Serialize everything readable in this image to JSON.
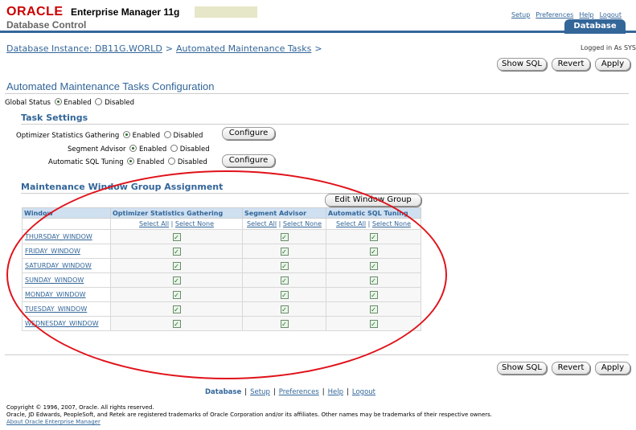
{
  "header": {
    "brand_oracle": "ORACLE",
    "brand_em": "Enterprise Manager 11g",
    "brand_dc": "Database Control",
    "global_links": [
      "Setup",
      "Preferences",
      "Help",
      "Logout"
    ],
    "tab": "Database"
  },
  "breadcrumb": {
    "items": [
      "Database Instance: DB11G.WORLD",
      "Automated Maintenance Tasks"
    ],
    "separator": ">"
  },
  "logged_in": "Logged in As SYS",
  "actions": {
    "show_sql": "Show SQL",
    "revert": "Revert",
    "apply": "Apply"
  },
  "page_title": "Automated Maintenance Tasks Configuration",
  "global_status": {
    "label": "Global Status",
    "enabled": "Enabled",
    "disabled": "Disabled",
    "value": "Enabled"
  },
  "task_settings": {
    "heading": "Task Settings",
    "rows": [
      {
        "label": "Optimizer Statistics Gathering",
        "value": "Enabled",
        "configure": "Configure"
      },
      {
        "label": "Segment Advisor",
        "value": "Enabled"
      },
      {
        "label": "Automatic SQL Tuning",
        "value": "Enabled",
        "configure": "Configure"
      }
    ],
    "enabled": "Enabled",
    "disabled": "Disabled"
  },
  "window_group": {
    "heading": "Maintenance Window Group Assignment",
    "edit_button": "Edit Window Group",
    "columns": [
      "Window",
      "Optimizer Statistics Gathering",
      "Segment Advisor",
      "Automatic SQL Tuning"
    ],
    "select_all": "Select All",
    "select_none": "Select None",
    "rows": [
      {
        "window": "THURSDAY_WINDOW",
        "checks": [
          true,
          true,
          true
        ]
      },
      {
        "window": "FRIDAY_WINDOW",
        "checks": [
          true,
          true,
          true
        ]
      },
      {
        "window": "SATURDAY_WINDOW",
        "checks": [
          true,
          true,
          true
        ]
      },
      {
        "window": "SUNDAY_WINDOW",
        "checks": [
          true,
          true,
          true
        ]
      },
      {
        "window": "MONDAY_WINDOW",
        "checks": [
          true,
          true,
          true
        ]
      },
      {
        "window": "TUESDAY_WINDOW",
        "checks": [
          true,
          true,
          true
        ]
      },
      {
        "window": "WEDNESDAY_WINDOW",
        "checks": [
          true,
          true,
          true
        ]
      }
    ]
  },
  "footer": {
    "links": [
      "Database",
      "Setup",
      "Preferences",
      "Help",
      "Logout"
    ],
    "copyright": "Copyright © 1996, 2007, Oracle. All rights reserved.",
    "trademark": "Oracle, JD Edwards, PeopleSoft, and Retek are registered trademarks of Oracle Corporation and/or its affiliates. Other names may be trademarks of their respective owners.",
    "about": "About Oracle Enterprise Manager"
  },
  "colors": {
    "accent": "#336699",
    "oracle_red": "#cc0000",
    "annotation": "#e0121a"
  }
}
